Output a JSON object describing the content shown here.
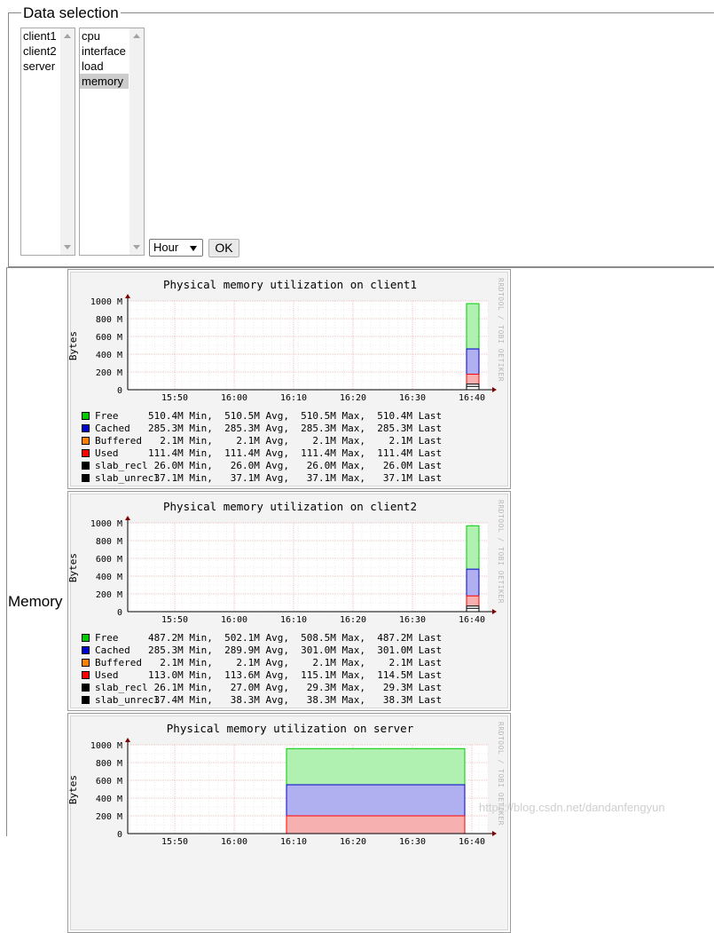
{
  "form": {
    "legend": "Data selection",
    "hosts": [
      "client1",
      "client2",
      "server"
    ],
    "plugins": [
      "cpu",
      "interface",
      "load",
      "memory"
    ],
    "selected_plugin": "memory",
    "timespan": "Hour",
    "ok_label": "OK"
  },
  "section_label": "Memory",
  "graph_common": {
    "ylabel": "Bytes",
    "yticks": [
      "1000 M",
      "800 M",
      "600 M",
      "400 M",
      "200 M",
      "0"
    ],
    "xticks": [
      "15:50",
      "16:00",
      "16:10",
      "16:20",
      "16:30",
      "16:40"
    ],
    "rrdtool": "RRDTOOL / TOBI OETIKER",
    "colors": {
      "Free": "#00cc00",
      "Cached": "#0000cc",
      "Buffered": "#ff8000",
      "Used": "#ff0000",
      "slab_recl": "#000000",
      "slab_unrecl": "#000000"
    }
  },
  "graphs": [
    {
      "title": "Physical memory utilization on client1",
      "rows": [
        {
          "name": "Free",
          "color": "#00cc00",
          "stats": "510.4M Min,  510.5M Avg,  510.5M Max,  510.4M Last"
        },
        {
          "name": "Cached",
          "color": "#0000cc",
          "stats": "285.3M Min,  285.3M Avg,  285.3M Max,  285.3M Last"
        },
        {
          "name": "Buffered",
          "color": "#ff8000",
          "stats": "  2.1M Min,    2.1M Avg,    2.1M Max,    2.1M Last"
        },
        {
          "name": "Used",
          "color": "#ff0000",
          "stats": "111.4M Min,  111.4M Avg,  111.4M Max,  111.4M Last"
        },
        {
          "name": "slab_recl",
          "color": "#000000",
          "stats": " 26.0M Min,   26.0M Avg,   26.0M Max,   26.0M Last"
        },
        {
          "name": "slab_unrecl",
          "color": "#000000",
          "stats": " 37.1M Min,   37.1M Avg,   37.1M Max,   37.1M Last"
        }
      ]
    },
    {
      "title": "Physical memory utilization on client2",
      "rows": [
        {
          "name": "Free",
          "color": "#00cc00",
          "stats": "487.2M Min,  502.1M Avg,  508.5M Max,  487.2M Last"
        },
        {
          "name": "Cached",
          "color": "#0000cc",
          "stats": "285.3M Min,  289.9M Avg,  301.0M Max,  301.0M Last"
        },
        {
          "name": "Buffered",
          "color": "#ff8000",
          "stats": "  2.1M Min,    2.1M Avg,    2.1M Max,    2.1M Last"
        },
        {
          "name": "Used",
          "color": "#ff0000",
          "stats": "113.0M Min,  113.6M Avg,  115.1M Max,  114.5M Last"
        },
        {
          "name": "slab_recl",
          "color": "#000000",
          "stats": " 26.1M Min,   27.0M Avg,   29.3M Max,   29.3M Last"
        },
        {
          "name": "slab_unrecl",
          "color": "#000000",
          "stats": " 37.4M Min,   38.3M Avg,   38.3M Max,   38.3M Last"
        }
      ]
    },
    {
      "title": "Physical memory utilization on server",
      "rows": []
    }
  ],
  "watermark": "https://blog.csdn.net/dandanfengyun"
}
